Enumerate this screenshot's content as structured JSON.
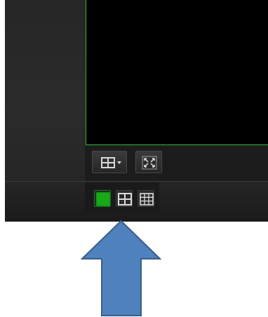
{
  "app": {
    "video_pane": {
      "border_color": "#2fbf3a",
      "background": "#000000"
    },
    "view_toolbar": {
      "buttons": [
        {
          "name": "split-layout-dropdown",
          "icon": "grid-2x2-dropdown-icon"
        },
        {
          "name": "fullscreen",
          "icon": "expand-arrows-icon"
        }
      ]
    },
    "layout_bar": {
      "buttons": [
        {
          "name": "layout-1x1",
          "icon": "single-pane-icon",
          "active": true,
          "color": "#1aa319"
        },
        {
          "name": "layout-2x2",
          "icon": "grid-2x2-icon",
          "active": false
        },
        {
          "name": "layout-3x3",
          "icon": "grid-3x3-icon",
          "active": false
        }
      ]
    }
  },
  "annotation": {
    "arrow_color": "#4f81bd",
    "arrow_stroke": "#385d8a",
    "direction": "up"
  }
}
